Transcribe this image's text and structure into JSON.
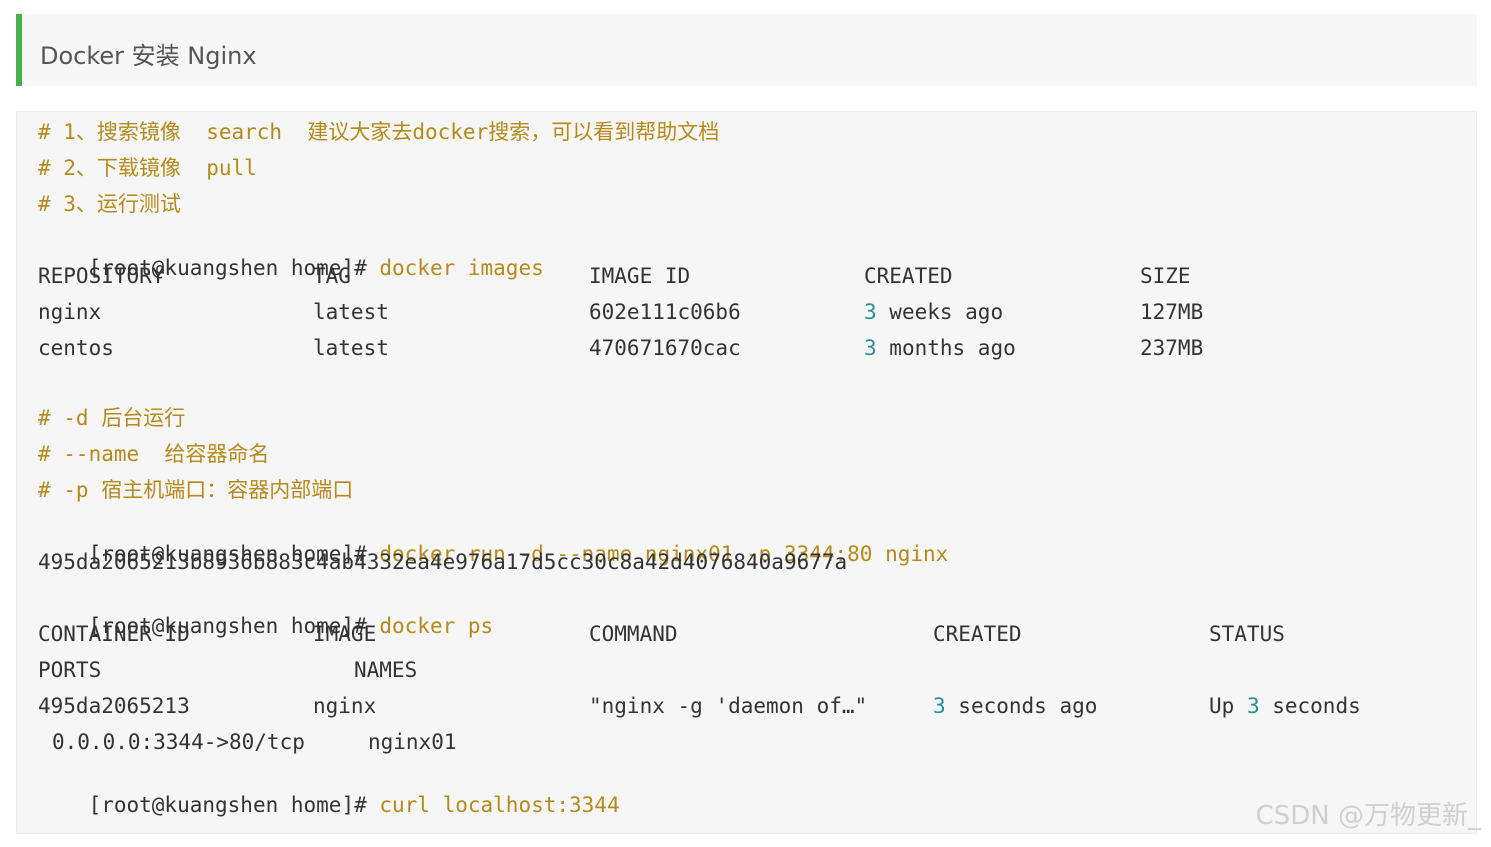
{
  "heading": {
    "title": "Docker 安装 Nginx"
  },
  "code": {
    "c1": "# 1、搜索镜像  search  建议大家去docker搜索，可以看到帮助文档",
    "c2": "# 2、下载镜像  pull",
    "c3": "# 3、运行测试",
    "prompt": "[root@kuangshen home]# ",
    "cmd_images": "docker images",
    "images_headers": [
      "REPOSITORY",
      "TAG",
      "IMAGE ID",
      "CREATED",
      "SIZE"
    ],
    "images_rows": [
      {
        "repo": "nginx",
        "tag": "latest",
        "id": "602e111c06b6",
        "created_num": "3",
        "created_rest": " weeks ago",
        "size": "127MB"
      },
      {
        "repo": "centos",
        "tag": "latest",
        "id": "470671670cac",
        "created_num": "3",
        "created_rest": " months ago",
        "size": "237MB"
      }
    ],
    "c4": "# -d 后台运行",
    "c5": "# --name  给容器命名",
    "c6": "# -p 宿主机端口：容器内部端口",
    "cmd_run": "docker run -d --name nginx01 -p 3344:80 nginx",
    "container_hash": "495da2065213b8936b883c4ab4332ea4e976a17d5cc30c8a42d4076840a9677a",
    "cmd_ps": "docker ps",
    "ps_headers": [
      "CONTAINER ID",
      "IMAGE",
      "COMMAND",
      "CREATED",
      "STATUS"
    ],
    "ps_headers2": [
      "PORTS",
      "NAMES"
    ],
    "ps_row": {
      "id": "495da2065213",
      "image": "nginx",
      "command": "\"nginx -g 'daemon of…\"",
      "created_num": "3",
      "created_rest": " seconds ago",
      "status_a": "Up ",
      "status_num": "3",
      "status_b": " seconds",
      "ports": "0.0.0.0:3344->80/tcp",
      "names": "nginx01"
    },
    "cmd_curl": "curl localhost:3344"
  },
  "watermark": "CSDN @万物更新_"
}
